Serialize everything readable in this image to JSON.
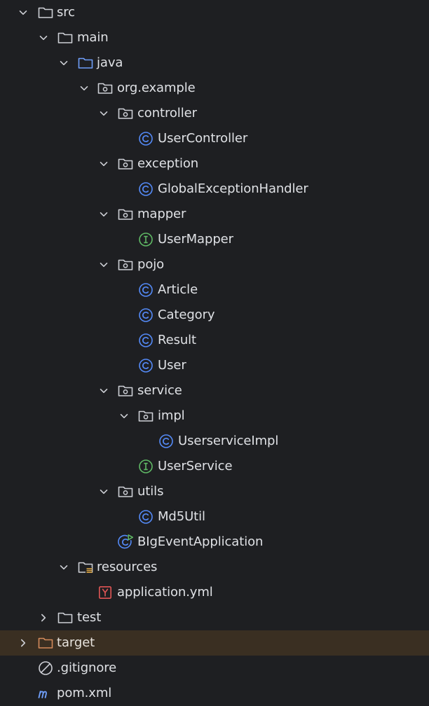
{
  "project_tree": {
    "items": [
      {
        "label": "src",
        "icon": "folder-icon",
        "expanded": true
      },
      {
        "label": "main",
        "icon": "folder-icon",
        "expanded": true
      },
      {
        "label": "java",
        "icon": "source-root-folder-icon",
        "expanded": true
      },
      {
        "label": "org.example",
        "icon": "package-icon",
        "expanded": true
      },
      {
        "label": "controller",
        "icon": "package-icon",
        "expanded": true
      },
      {
        "label": "UserController",
        "icon": "class-icon"
      },
      {
        "label": "exception",
        "icon": "package-icon",
        "expanded": true
      },
      {
        "label": "GlobalExceptionHandler",
        "icon": "class-icon"
      },
      {
        "label": "mapper",
        "icon": "package-icon",
        "expanded": true
      },
      {
        "label": "UserMapper",
        "icon": "interface-icon"
      },
      {
        "label": "pojo",
        "icon": "package-icon",
        "expanded": true
      },
      {
        "label": "Article",
        "icon": "class-icon"
      },
      {
        "label": "Category",
        "icon": "class-icon"
      },
      {
        "label": "Result",
        "icon": "class-icon"
      },
      {
        "label": "User",
        "icon": "class-icon"
      },
      {
        "label": "service",
        "icon": "package-icon",
        "expanded": true
      },
      {
        "label": "impl",
        "icon": "package-icon",
        "expanded": true
      },
      {
        "label": "UserserviceImpl",
        "icon": "class-icon"
      },
      {
        "label": "UserService",
        "icon": "interface-icon"
      },
      {
        "label": "utils",
        "icon": "package-icon",
        "expanded": true
      },
      {
        "label": "Md5Util",
        "icon": "class-icon"
      },
      {
        "label": "BIgEventApplication",
        "icon": "spring-boot-class-icon"
      },
      {
        "label": "resources",
        "icon": "resources-folder-icon",
        "expanded": true
      },
      {
        "label": "application.yml",
        "icon": "yaml-file-icon"
      },
      {
        "label": "test",
        "icon": "folder-icon",
        "expanded": false
      },
      {
        "label": "target",
        "icon": "excluded-folder-icon",
        "expanded": false
      },
      {
        "label": ".gitignore",
        "icon": "ignore-file-icon"
      },
      {
        "label": "pom.xml",
        "icon": "maven-icon"
      }
    ]
  },
  "colors": {
    "background": "#1e1f22",
    "target_row_highlight": "#3a2f22",
    "text": "#dfe1e5",
    "class_icon": "#548af7",
    "interface_icon": "#5fb865",
    "excluded_folder": "#d38a5b",
    "yaml_icon": "#e05555",
    "maven_icon": "#6f9ef8"
  }
}
